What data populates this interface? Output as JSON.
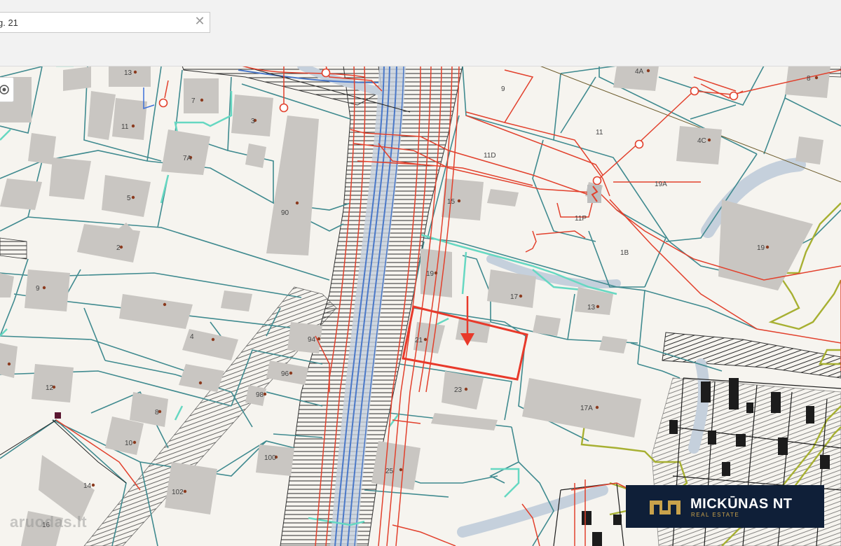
{
  "search": {
    "value": "g. 21"
  },
  "icons": {
    "clear": "✕",
    "clear_name": "close-icon",
    "locate_name": "locate-icon"
  },
  "colors": {
    "parcel": "#3f8a8f",
    "building": "#c9c6c2",
    "utility_red": "#e2402c",
    "utility_blue": "#4a78c8",
    "aqua": "#66d8c2",
    "olive": "#a7b032",
    "highlight": "#e8392a",
    "logo_bg": "#0f1f38",
    "logo_gold": "#c9a24b"
  },
  "plots": [
    {
      "id": "13",
      "label": "13"
    },
    {
      "id": "7",
      "label": "7"
    },
    {
      "id": "11",
      "label": "11"
    },
    {
      "id": "3",
      "label": "3"
    },
    {
      "id": "7A",
      "label": "7A"
    },
    {
      "id": "5",
      "label": "5"
    },
    {
      "id": "90",
      "label": "90"
    },
    {
      "id": "2",
      "label": "2"
    },
    {
      "id": "9",
      "label": "9"
    },
    {
      "id": "4",
      "label": "4"
    },
    {
      "id": "94",
      "label": "94"
    },
    {
      "id": "96",
      "label": "96"
    },
    {
      "id": "98",
      "label": "98"
    },
    {
      "id": "12",
      "label": "12"
    },
    {
      "id": "8",
      "label": "8"
    },
    {
      "id": "10",
      "label": "10"
    },
    {
      "id": "100",
      "label": "100"
    },
    {
      "id": "102",
      "label": "102"
    },
    {
      "id": "14",
      "label": "14"
    },
    {
      "id": "16",
      "label": "16"
    },
    {
      "id": "9b",
      "label": "9"
    },
    {
      "id": "11D",
      "label": "11D"
    },
    {
      "id": "11b",
      "label": "11"
    },
    {
      "id": "4A",
      "label": "4A"
    },
    {
      "id": "8b",
      "label": "8"
    },
    {
      "id": "4C",
      "label": "4C"
    },
    {
      "id": "19A",
      "label": "19A"
    },
    {
      "id": "15",
      "label": "15"
    },
    {
      "id": "11P",
      "label": "11P"
    },
    {
      "id": "1B",
      "label": "1B"
    },
    {
      "id": "19",
      "label": "19"
    },
    {
      "id": "19b",
      "label": "19"
    },
    {
      "id": "17",
      "label": "17"
    },
    {
      "id": "13b",
      "label": "13"
    },
    {
      "id": "21",
      "label": "21"
    },
    {
      "id": "23",
      "label": "23"
    },
    {
      "id": "17A",
      "label": "17A"
    },
    {
      "id": "25",
      "label": "25"
    }
  ],
  "logo": {
    "name": "MICKŪNAS NT",
    "sub": "REAL ESTATE"
  },
  "watermark": "aruodas.lt"
}
